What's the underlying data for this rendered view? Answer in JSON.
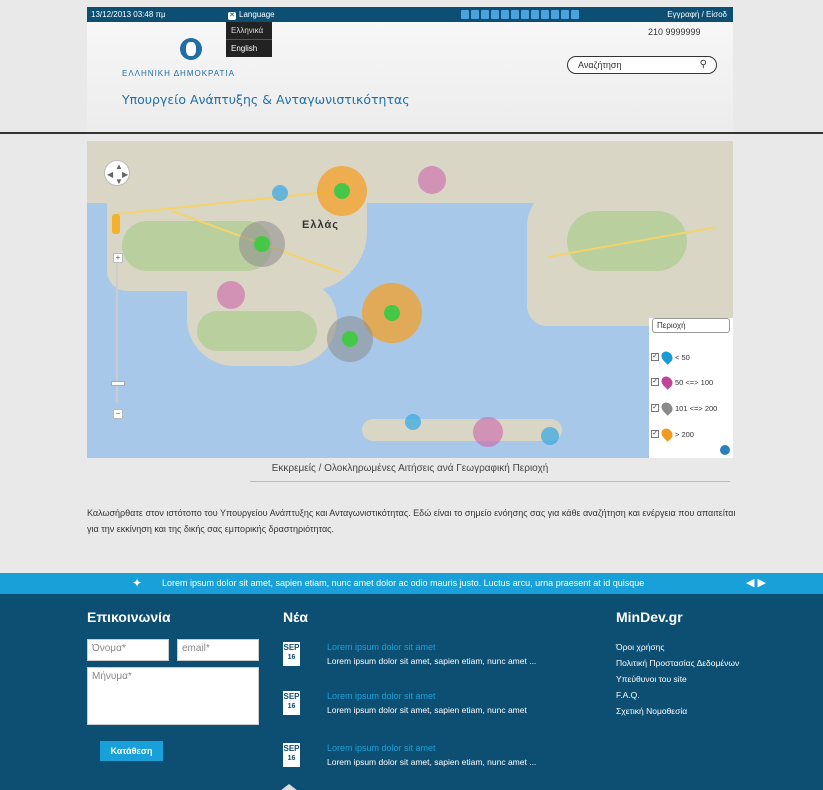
{
  "topbar": {
    "datetime": "13/12/2013 03:48 πμ",
    "language_label": "Language",
    "login": "Εγγραφή  /  Είσοδ"
  },
  "language_menu": {
    "items": [
      "Ελληνικά",
      "English"
    ]
  },
  "header": {
    "country": "ΕΛΛΗΝΙΚΗ ΔΗΜΟΚΡΑΤΙΑ",
    "ministry": "Υπουργείο Ανάπτυξης & Ανταγωνιστικότητας",
    "phone": "210 9999999",
    "search_placeholder": "Αναζήτηση"
  },
  "map": {
    "country_label": "Ελλάς",
    "legend": {
      "region_label": "Περιοχή",
      "rows": [
        {
          "label": "< 50",
          "color": "#1a9ad6"
        },
        {
          "label": "50 <=> 100",
          "color": "#c0449a"
        },
        {
          "label": "101 <=> 200",
          "color": "#8a8a8a"
        },
        {
          "label": "> 200",
          "color": "#f09a1e"
        }
      ]
    },
    "caption": "Εκκρεμείς / Ολοκληρωμένες Αιτήσεις ανά Γεωγραφική Περιοχή"
  },
  "welcome": {
    "text": "Καλωσήρθατε στον ιστότοπο του Υπουργείου Ανάπτυξης και Ανταγωνιστικότητας. Εδώ είναι το σημείο ενόησης σας για κάθε αναζήτηση και ενέργεια που απαιτείται για την εκκίνηση και της δικής σας εμπορικής δραστηριότητας."
  },
  "ticker": {
    "text": "Lorem ipsum dolor sit amet, sapien etiam, nunc amet dolor ac odio mauris justo. Luctus arcu, urna praesent at id quisque"
  },
  "footer": {
    "contact": {
      "title": "Επικοινωνία",
      "name_placeholder": "Όνομα*",
      "email_placeholder": "email*",
      "message_placeholder": "Μήνυμα*",
      "submit": "Κατάθεση"
    },
    "news": {
      "title": "Νέα",
      "items": [
        {
          "month": "SEP",
          "day": "16",
          "title": "Lorem ipsum dolor sit amet",
          "body": "Lorem ipsum dolor sit amet, sapien etiam, nunc amet ..."
        },
        {
          "month": "SEP",
          "day": "16",
          "title": "Lorem ipsum dolor sit amet",
          "body": "Lorem ipsum dolor sit amet, sapien etiam, nunc amet"
        },
        {
          "month": "SEP",
          "day": "16",
          "title": "Lorem ipsum dolor sit amet",
          "body": "Lorem ipsum dolor sit amet, sapien etiam, nunc amet ..."
        }
      ]
    },
    "mindev": {
      "title": "MinDev.gr",
      "links": [
        "Όροι χρήσης",
        "Πολιτική Προστασίας Δεδομένων",
        "Υπεύθυνοι του site",
        "F.A.Q.",
        "Σχετική Νομοθεσία"
      ]
    }
  }
}
